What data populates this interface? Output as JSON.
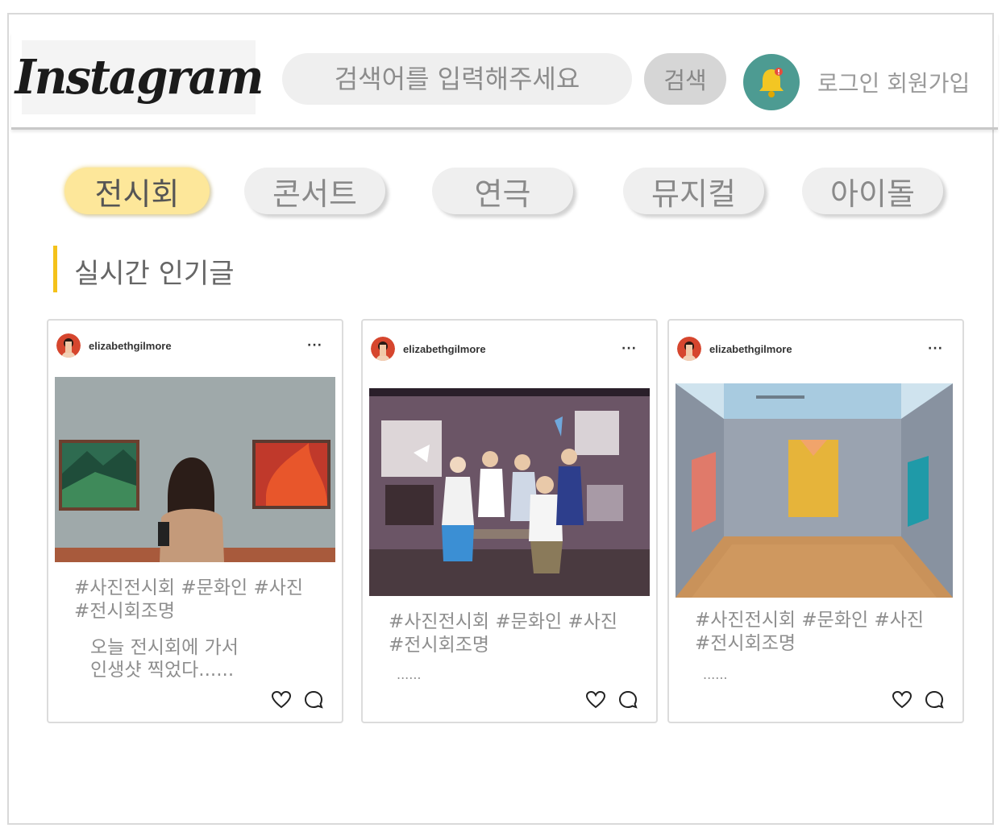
{
  "header": {
    "logo": "Instagram",
    "search_placeholder": "검색어를 입력해주세요",
    "search_button": "검색",
    "login": "로그인",
    "signup": "회원가입",
    "notification_icon": "bell-icon"
  },
  "tabs": [
    {
      "label": "전시회",
      "active": true
    },
    {
      "label": "콘서트",
      "active": false
    },
    {
      "label": "연극",
      "active": false
    },
    {
      "label": "뮤지컬",
      "active": false
    },
    {
      "label": "아이돌",
      "active": false
    }
  ],
  "section": {
    "title": "실시간 인기글"
  },
  "posts": [
    {
      "username": "elizabethgilmore",
      "more": "···",
      "tags_line1": "#사진전시회 #문화인 #사진",
      "tags_line2": "#전시회조명",
      "desc_line1": "오늘 전시회에 가서",
      "desc_line2": "인생샷 찍었다......"
    },
    {
      "username": "elizabethgilmore",
      "more": "···",
      "tags_line1": "#사진전시회 #문화인 #사진",
      "tags_line2": "#전시회조명",
      "desc_line1": "......"
    },
    {
      "username": "elizabethgilmore",
      "more": "···",
      "tags_line1": "#사진전시회 #문화인 #사진",
      "tags_line2": "#전시회조명",
      "desc_line1": "......"
    }
  ],
  "colors": {
    "accent": "#fde79a",
    "section_bar": "#f4c21a",
    "bell_bg": "#4d9b92",
    "bell": "#f3c623"
  }
}
